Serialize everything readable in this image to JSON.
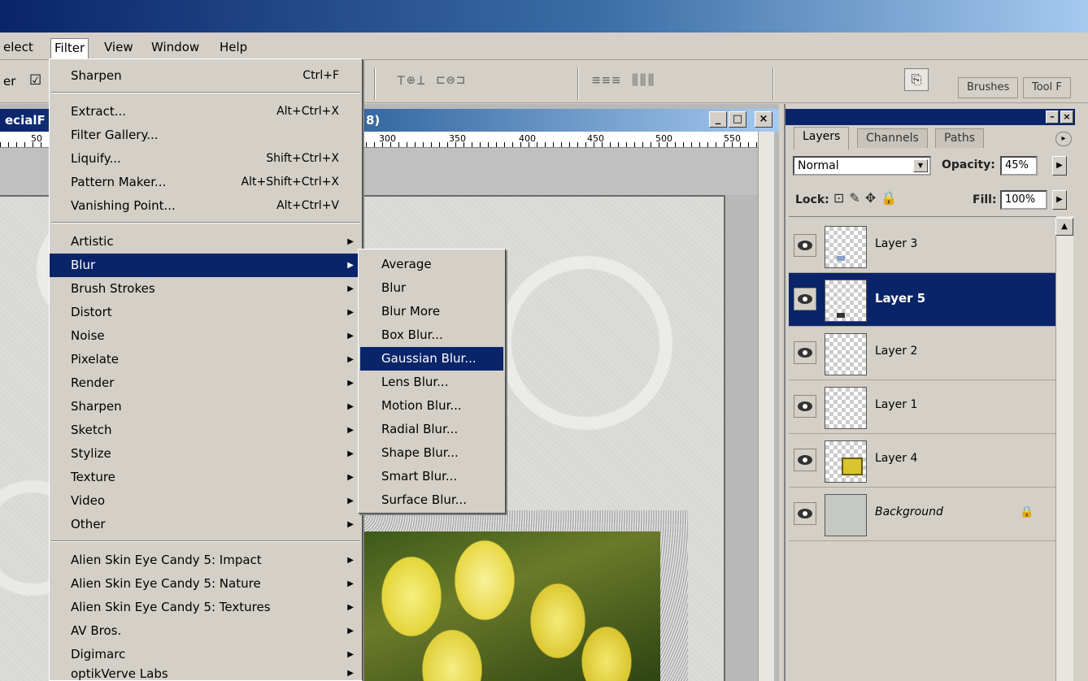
{
  "menubar": {
    "items": [
      {
        "label": "elect"
      },
      {
        "label": "Filter"
      },
      {
        "label": "View"
      },
      {
        "label": "Window"
      },
      {
        "label": "Help"
      }
    ]
  },
  "options_bar": {
    "left_label": "er",
    "checkbox": "☑"
  },
  "palette_well": {
    "tabs": [
      "Brushes",
      "Tool F"
    ]
  },
  "document": {
    "title_left": "ecialF",
    "title_right": "8)",
    "ruler_marks": [
      "50",
      "300",
      "350",
      "400",
      "450",
      "500",
      "550"
    ]
  },
  "filter_menu": {
    "items": [
      {
        "label": "Sharpen",
        "shortcut": "Ctrl+F"
      },
      {
        "label": "Extract...",
        "shortcut": "Alt+Ctrl+X"
      },
      {
        "label": "Filter Gallery...",
        "shortcut": ""
      },
      {
        "label": "Liquify...",
        "shortcut": "Shift+Ctrl+X"
      },
      {
        "label": "Pattern Maker...",
        "shortcut": "Alt+Shift+Ctrl+X"
      },
      {
        "label": "Vanishing Point...",
        "shortcut": "Alt+Ctrl+V"
      },
      {
        "label": "Artistic"
      },
      {
        "label": "Blur"
      },
      {
        "label": "Brush Strokes"
      },
      {
        "label": "Distort"
      },
      {
        "label": "Noise"
      },
      {
        "label": "Pixelate"
      },
      {
        "label": "Render"
      },
      {
        "label": "Sharpen"
      },
      {
        "label": "Sketch"
      },
      {
        "label": "Stylize"
      },
      {
        "label": "Texture"
      },
      {
        "label": "Video"
      },
      {
        "label": "Other"
      },
      {
        "label": "Alien Skin Eye Candy 5: Impact"
      },
      {
        "label": "Alien Skin Eye Candy 5: Nature"
      },
      {
        "label": "Alien Skin Eye Candy 5: Textures"
      },
      {
        "label": "AV Bros."
      },
      {
        "label": "Digimarc"
      },
      {
        "label": "optikVerve Labs"
      }
    ]
  },
  "blur_menu": {
    "items": [
      "Average",
      "Blur",
      "Blur More",
      "Box Blur...",
      "Gaussian Blur...",
      "Lens Blur...",
      "Motion Blur...",
      "Radial Blur...",
      "Shape Blur...",
      "Smart Blur...",
      "Surface Blur..."
    ],
    "highlighted": "Gaussian Blur..."
  },
  "layers_panel": {
    "tabs": [
      "Layers",
      "Channels",
      "Paths"
    ],
    "blend_mode": "Normal",
    "opacity_label": "Opacity:",
    "opacity_value": "45%",
    "lock_label": "Lock:",
    "fill_label": "Fill:",
    "fill_value": "100%",
    "layers": [
      {
        "name": "Layer 3"
      },
      {
        "name": "Layer 5"
      },
      {
        "name": "Layer 2"
      },
      {
        "name": "Layer 1"
      },
      {
        "name": "Layer 4"
      },
      {
        "name": "Background"
      }
    ],
    "selected_layer": "Layer 5"
  }
}
